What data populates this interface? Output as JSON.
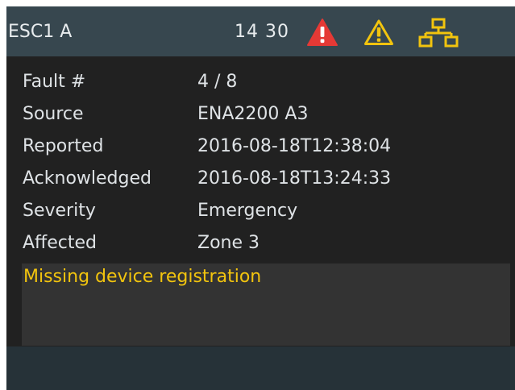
{
  "header": {
    "title": "ESC1 A",
    "time": "14 30",
    "icons": [
      "alarm-critical-icon",
      "warning-icon",
      "network-icon"
    ]
  },
  "fault": {
    "rows": [
      {
        "label": "Fault #",
        "value": "4 / 8"
      },
      {
        "label": "Source",
        "value": "ENA2200 A3"
      },
      {
        "label": "Reported",
        "value": "2016-08-18T12:38:04"
      },
      {
        "label": "Acknowledged",
        "value": "2016-08-18T13:24:33"
      },
      {
        "label": "Severity",
        "value": "Emergency"
      },
      {
        "label": "Affected",
        "value": "Zone 3"
      }
    ],
    "message": "Missing device registration"
  },
  "colors": {
    "header_bg": "#37474f",
    "panel_bg": "#212121",
    "message_bg": "#333333",
    "message_text": "#f2c40e",
    "alarm_red": "#e53935",
    "warning_yellow": "#f2c40e"
  }
}
